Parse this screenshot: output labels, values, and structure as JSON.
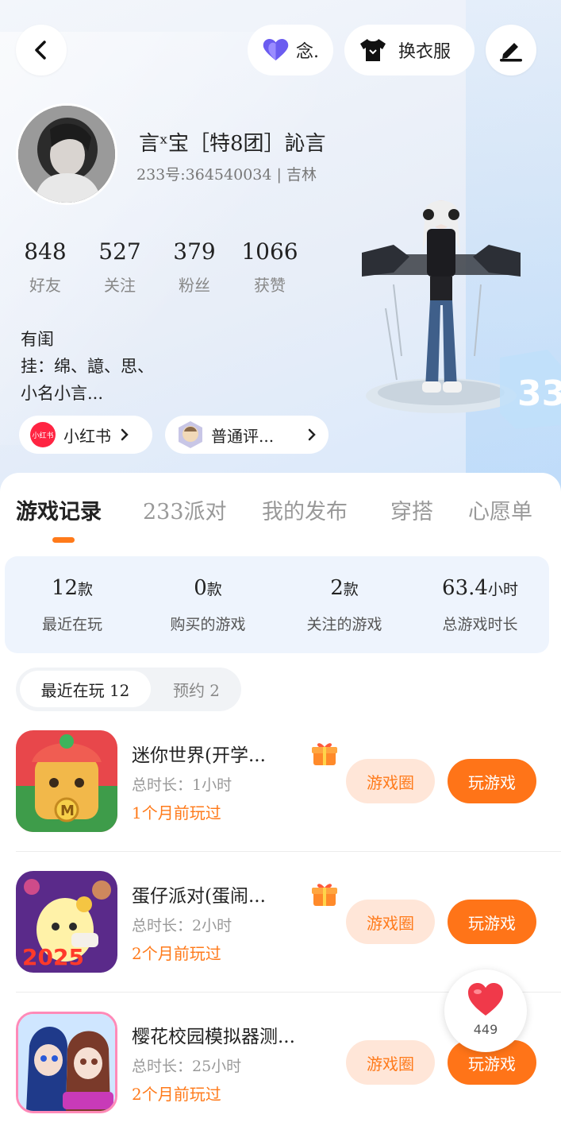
{
  "header": {
    "mood_label": "念.",
    "outfit_label": "换衣服"
  },
  "profile": {
    "name": "言ˣ宝［特8团］訫言",
    "uid_line": "233号:364540034 | 吉林",
    "stats": [
      {
        "value": "848",
        "label": "好友"
      },
      {
        "value": "527",
        "label": "关注"
      },
      {
        "value": "379",
        "label": "粉丝"
      },
      {
        "value": "1066",
        "label": "获赞"
      }
    ],
    "bio_lines": [
      "有闺",
      "挂：绵、譩、思、",
      "小名小言..."
    ],
    "links": [
      {
        "logo_text": "小红书",
        "label": "小红书"
      },
      {
        "label": "普通评..."
      }
    ]
  },
  "tabs": [
    "游戏记录",
    "233派对",
    "我的发布",
    "穿搭",
    "心愿单"
  ],
  "active_tab": 0,
  "summary": [
    {
      "value": "12",
      "unit": "款",
      "label": "最近在玩"
    },
    {
      "value": "0",
      "unit": "款",
      "label": "购买的游戏"
    },
    {
      "value": "2",
      "unit": "款",
      "label": "关注的游戏"
    },
    {
      "value": "63.4",
      "unit": "小时",
      "label": "总游戏时长"
    }
  ],
  "segments": {
    "recent": "最近在玩 12",
    "reserve": "预约 2"
  },
  "games": [
    {
      "title": "迷你世界(开学...",
      "time": "总时长：1小时",
      "last": "1个月前玩过",
      "gift": true
    },
    {
      "title": "蛋仔派对(蛋闹...",
      "time": "总时长：2小时",
      "last": "2个月前玩过",
      "gift": true
    },
    {
      "title": "樱花校园模拟器测...",
      "time": "总时长：25小时",
      "last": "2个月前玩过",
      "gift": false
    }
  ],
  "game_buttons": {
    "circle": "游戏圈",
    "play": "玩游戏"
  },
  "like": {
    "count": "449"
  },
  "colors": {
    "accent": "#ff7418",
    "accent_light": "#ffe6d8",
    "summary_bg": "#eef4fd",
    "heart": "#f0394a",
    "mood_icon": "#6b5cf0"
  },
  "icons": [
    "back-icon",
    "heart-mood-icon",
    "shirt-icon",
    "edit-icon",
    "chevron-right-icon",
    "gift-icon",
    "heart-like-icon"
  ]
}
